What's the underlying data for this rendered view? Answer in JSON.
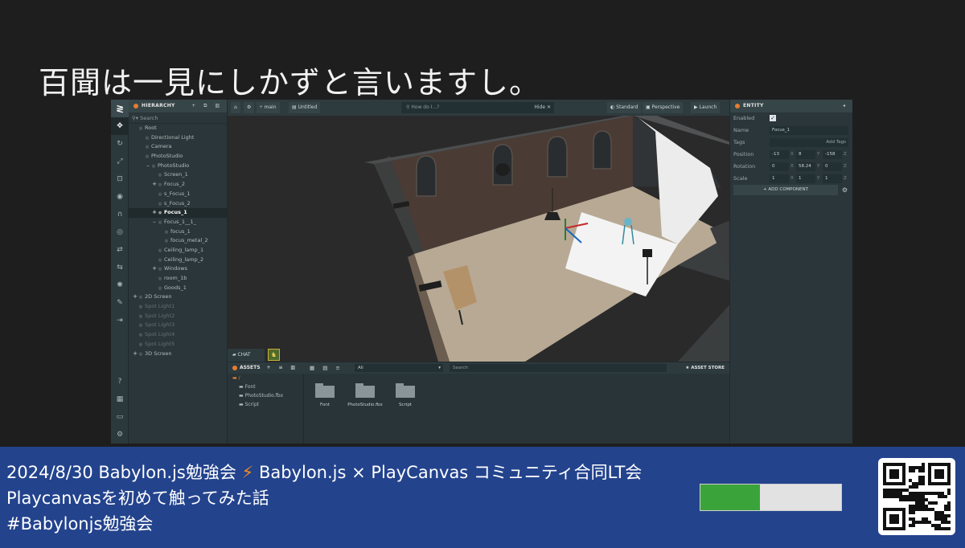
{
  "slide": {
    "title": "百聞は一見にしかずと言いますし。"
  },
  "editor": {
    "toolrail": {
      "tools": [
        "logo-icon",
        "move-icon",
        "rotate-icon",
        "scale-icon",
        "resize-icon",
        "world-icon",
        "magnet-icon",
        "eye-icon",
        "undo-icon",
        "redo-icon",
        "light-icon",
        "edit-icon",
        "publish-icon"
      ],
      "bottom": [
        "help-icon",
        "chart-icon",
        "chat-icon",
        "settings-icon"
      ]
    },
    "hierarchy": {
      "title": "HIERARCHY",
      "search_placeholder": "Search",
      "items": [
        {
          "label": "Root",
          "level": 0,
          "exp": "",
          "state": "normal"
        },
        {
          "label": "Directional Light",
          "level": 1,
          "exp": "",
          "state": "normal"
        },
        {
          "label": "Camera",
          "level": 1,
          "exp": "",
          "state": "normal"
        },
        {
          "label": "PhotoStudio",
          "level": 1,
          "exp": "",
          "state": "normal"
        },
        {
          "label": "PhotoStudio",
          "level": 2,
          "exp": "–",
          "state": "normal"
        },
        {
          "label": "Screen_1",
          "level": 3,
          "exp": "",
          "state": "normal"
        },
        {
          "label": "Focus_2",
          "level": 3,
          "exp": "+",
          "state": "normal"
        },
        {
          "label": "s_Focus_1",
          "level": 3,
          "exp": "",
          "state": "normal"
        },
        {
          "label": "s_Focus_2",
          "level": 3,
          "exp": "",
          "state": "normal"
        },
        {
          "label": "Focus_1",
          "level": 3,
          "exp": "+",
          "state": "selected"
        },
        {
          "label": "Focus_1__1_",
          "level": 3,
          "exp": "–",
          "state": "normal"
        },
        {
          "label": "focus_1",
          "level": 4,
          "exp": "",
          "state": "normal"
        },
        {
          "label": "focus_metal_2",
          "level": 4,
          "exp": "",
          "state": "normal"
        },
        {
          "label": "Ceiling_lamp_1",
          "level": 3,
          "exp": "",
          "state": "normal"
        },
        {
          "label": "Ceiling_lamp_2",
          "level": 3,
          "exp": "",
          "state": "normal"
        },
        {
          "label": "Windows",
          "level": 3,
          "exp": "+",
          "state": "normal"
        },
        {
          "label": "room_1b",
          "level": 3,
          "exp": "",
          "state": "normal"
        },
        {
          "label": "Goods_1",
          "level": 3,
          "exp": "",
          "state": "normal"
        },
        {
          "label": "2D Screen",
          "level": 0,
          "exp": "+",
          "state": "normal"
        },
        {
          "label": "Spot Light1",
          "level": 0,
          "exp": "",
          "state": "disabled"
        },
        {
          "label": "Spot Light2",
          "level": 0,
          "exp": "",
          "state": "disabled"
        },
        {
          "label": "Spot Light3",
          "level": 0,
          "exp": "",
          "state": "disabled"
        },
        {
          "label": "Spot Light4",
          "level": 0,
          "exp": "",
          "state": "disabled"
        },
        {
          "label": "Spot Light5",
          "level": 0,
          "exp": "",
          "state": "disabled"
        },
        {
          "label": "3D Screen",
          "level": 0,
          "exp": "+",
          "state": "normal"
        }
      ]
    },
    "viewport": {
      "branch": "main",
      "scene": "Untitled",
      "search_placeholder": "How do I...?",
      "hide_label": "Hide",
      "render_mode": "Standard",
      "camera": "Perspective",
      "launch": "Launch",
      "chat_tab": "CHAT"
    },
    "entity": {
      "title": "ENTITY",
      "enabled_label": "Enabled",
      "name_label": "Name",
      "name_value": "Focus_1",
      "tags_label": "Tags",
      "add_tags": "Add Tags",
      "position_label": "Position",
      "position": [
        "-13",
        "8",
        "-158"
      ],
      "rotation_label": "Rotation",
      "rotation": [
        "0",
        "58.24",
        "0"
      ],
      "scale_label": "Scale",
      "scale": [
        "1",
        "1",
        "1"
      ],
      "axes": [
        "X",
        "Y",
        "Z"
      ],
      "add_component": "ADD COMPONENT"
    },
    "assets": {
      "title": "ASSETS",
      "filter_value": "All",
      "search_placeholder": "Search",
      "store_label": "ASSET STORE",
      "tree": [
        "/",
        "Font",
        "PhotoStudio.fbx",
        "Script"
      ],
      "folders": [
        "Font",
        "PhotoStudio.fbx",
        "Script"
      ]
    }
  },
  "banner": {
    "line1_pre": "2024/8/30 Babylon.js勉強会",
    "line1_sep": "⚡",
    "line1_post": "Babylon.js × PlayCanvas コミュニティ合同LT会",
    "line2": "Playcanvasを初めて触ってみた話",
    "line3": "#Babylonjs勉強会",
    "progress": 0.42
  },
  "colors": {
    "banner_bg": "#23438d",
    "accent_orange": "#e47d33",
    "progress_fill": "#3aa43a"
  }
}
